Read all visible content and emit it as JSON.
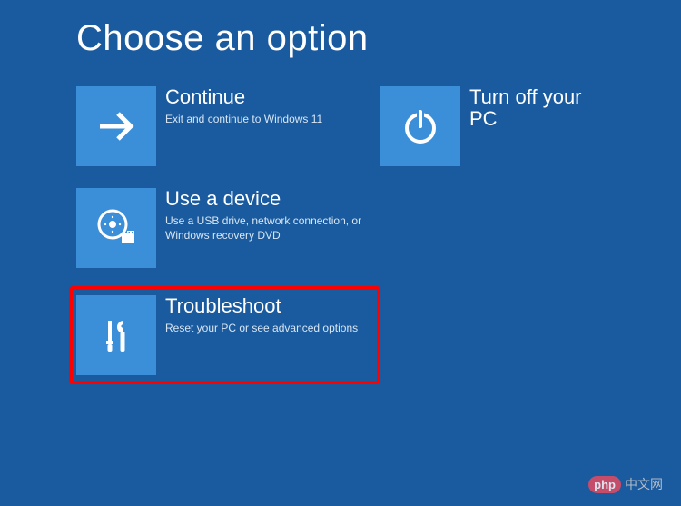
{
  "page_title": "Choose an option",
  "options": {
    "continue": {
      "title": "Continue",
      "desc": "Exit and continue to Windows 11"
    },
    "turnoff": {
      "title": "Turn off your PC"
    },
    "device": {
      "title": "Use a device",
      "desc": "Use a USB drive, network connection, or Windows recovery DVD"
    },
    "troubleshoot": {
      "title": "Troubleshoot",
      "desc": "Reset your PC or see advanced options"
    }
  },
  "watermark": {
    "logo": "php",
    "text": "中文网"
  }
}
